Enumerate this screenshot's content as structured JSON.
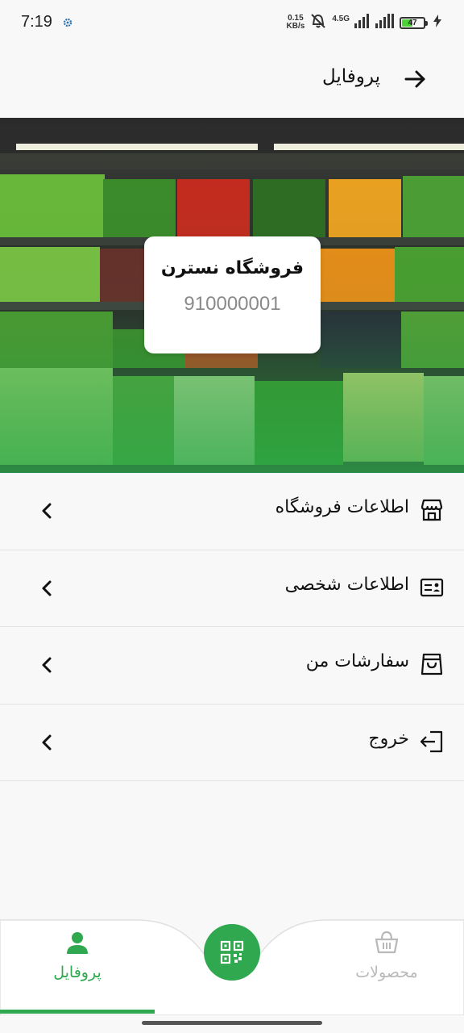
{
  "status_bar": {
    "time": "7:19",
    "speed_value": "0.15",
    "speed_unit": "KB/s",
    "network": "4.5G",
    "battery_level": "47",
    "icons": [
      "gear-icon",
      "mute-icon",
      "signal-icon",
      "battery-icon",
      "charging-icon"
    ]
  },
  "header": {
    "title": "پروفایل",
    "back_icon": "arrow-right-icon"
  },
  "store": {
    "name": "فروشگاه نسترن",
    "code": "910000001"
  },
  "menu": {
    "items": [
      {
        "label": "اطلاعات فروشگاه",
        "icon": "store-icon"
      },
      {
        "label": "اطلاعات شخصی",
        "icon": "id-card-icon"
      },
      {
        "label": "سفارشات من",
        "icon": "shopping-bag-icon"
      },
      {
        "label": "خروج",
        "icon": "logout-icon"
      }
    ]
  },
  "bottom_nav": {
    "profile_label": "پروفایل",
    "products_label": "محصولات",
    "active": "profile",
    "center_icon": "qr-code-icon"
  },
  "colors": {
    "accent": "#2fa84f",
    "inactive": "#b9b9b9",
    "background": "#f8f8f8"
  }
}
